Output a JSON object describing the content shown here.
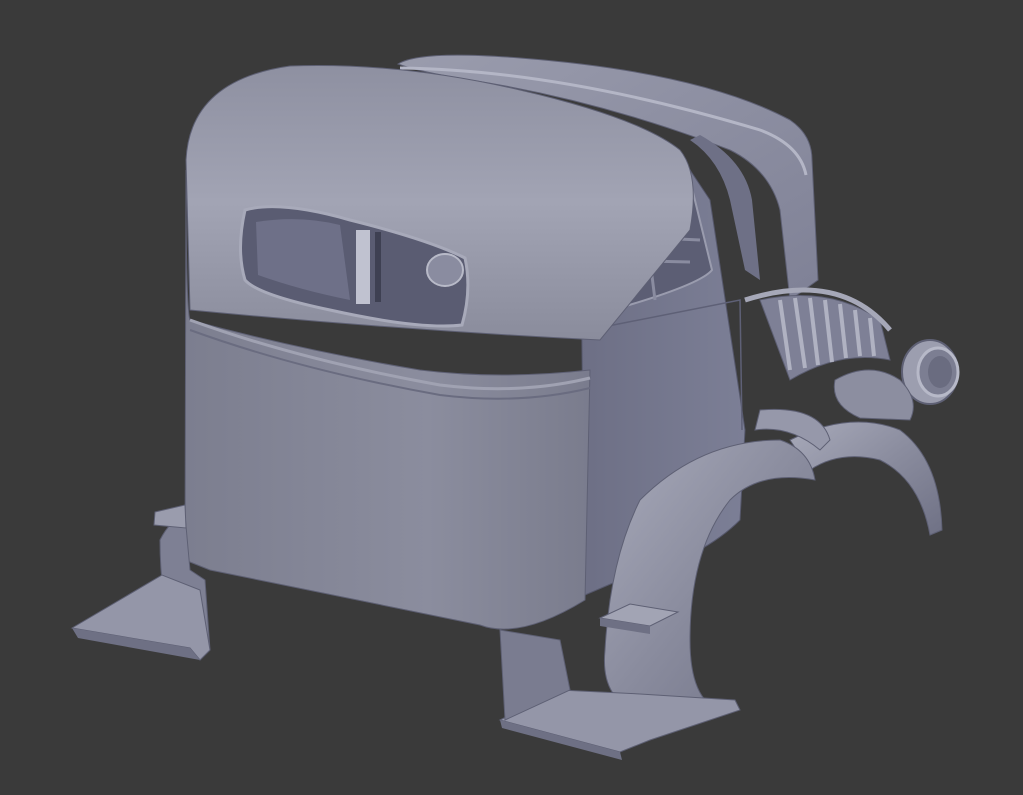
{
  "viewport": {
    "background": "#3a3a3a",
    "model_color": "#8a8c9e"
  },
  "model": {
    "parts": [
      "cab-roof",
      "cab-back-panel",
      "rear-window",
      "door",
      "hood",
      "radiator-grille",
      "headlight",
      "front-fender",
      "rear-fender-left",
      "running-board-left",
      "running-board-right",
      "step-plate"
    ]
  }
}
